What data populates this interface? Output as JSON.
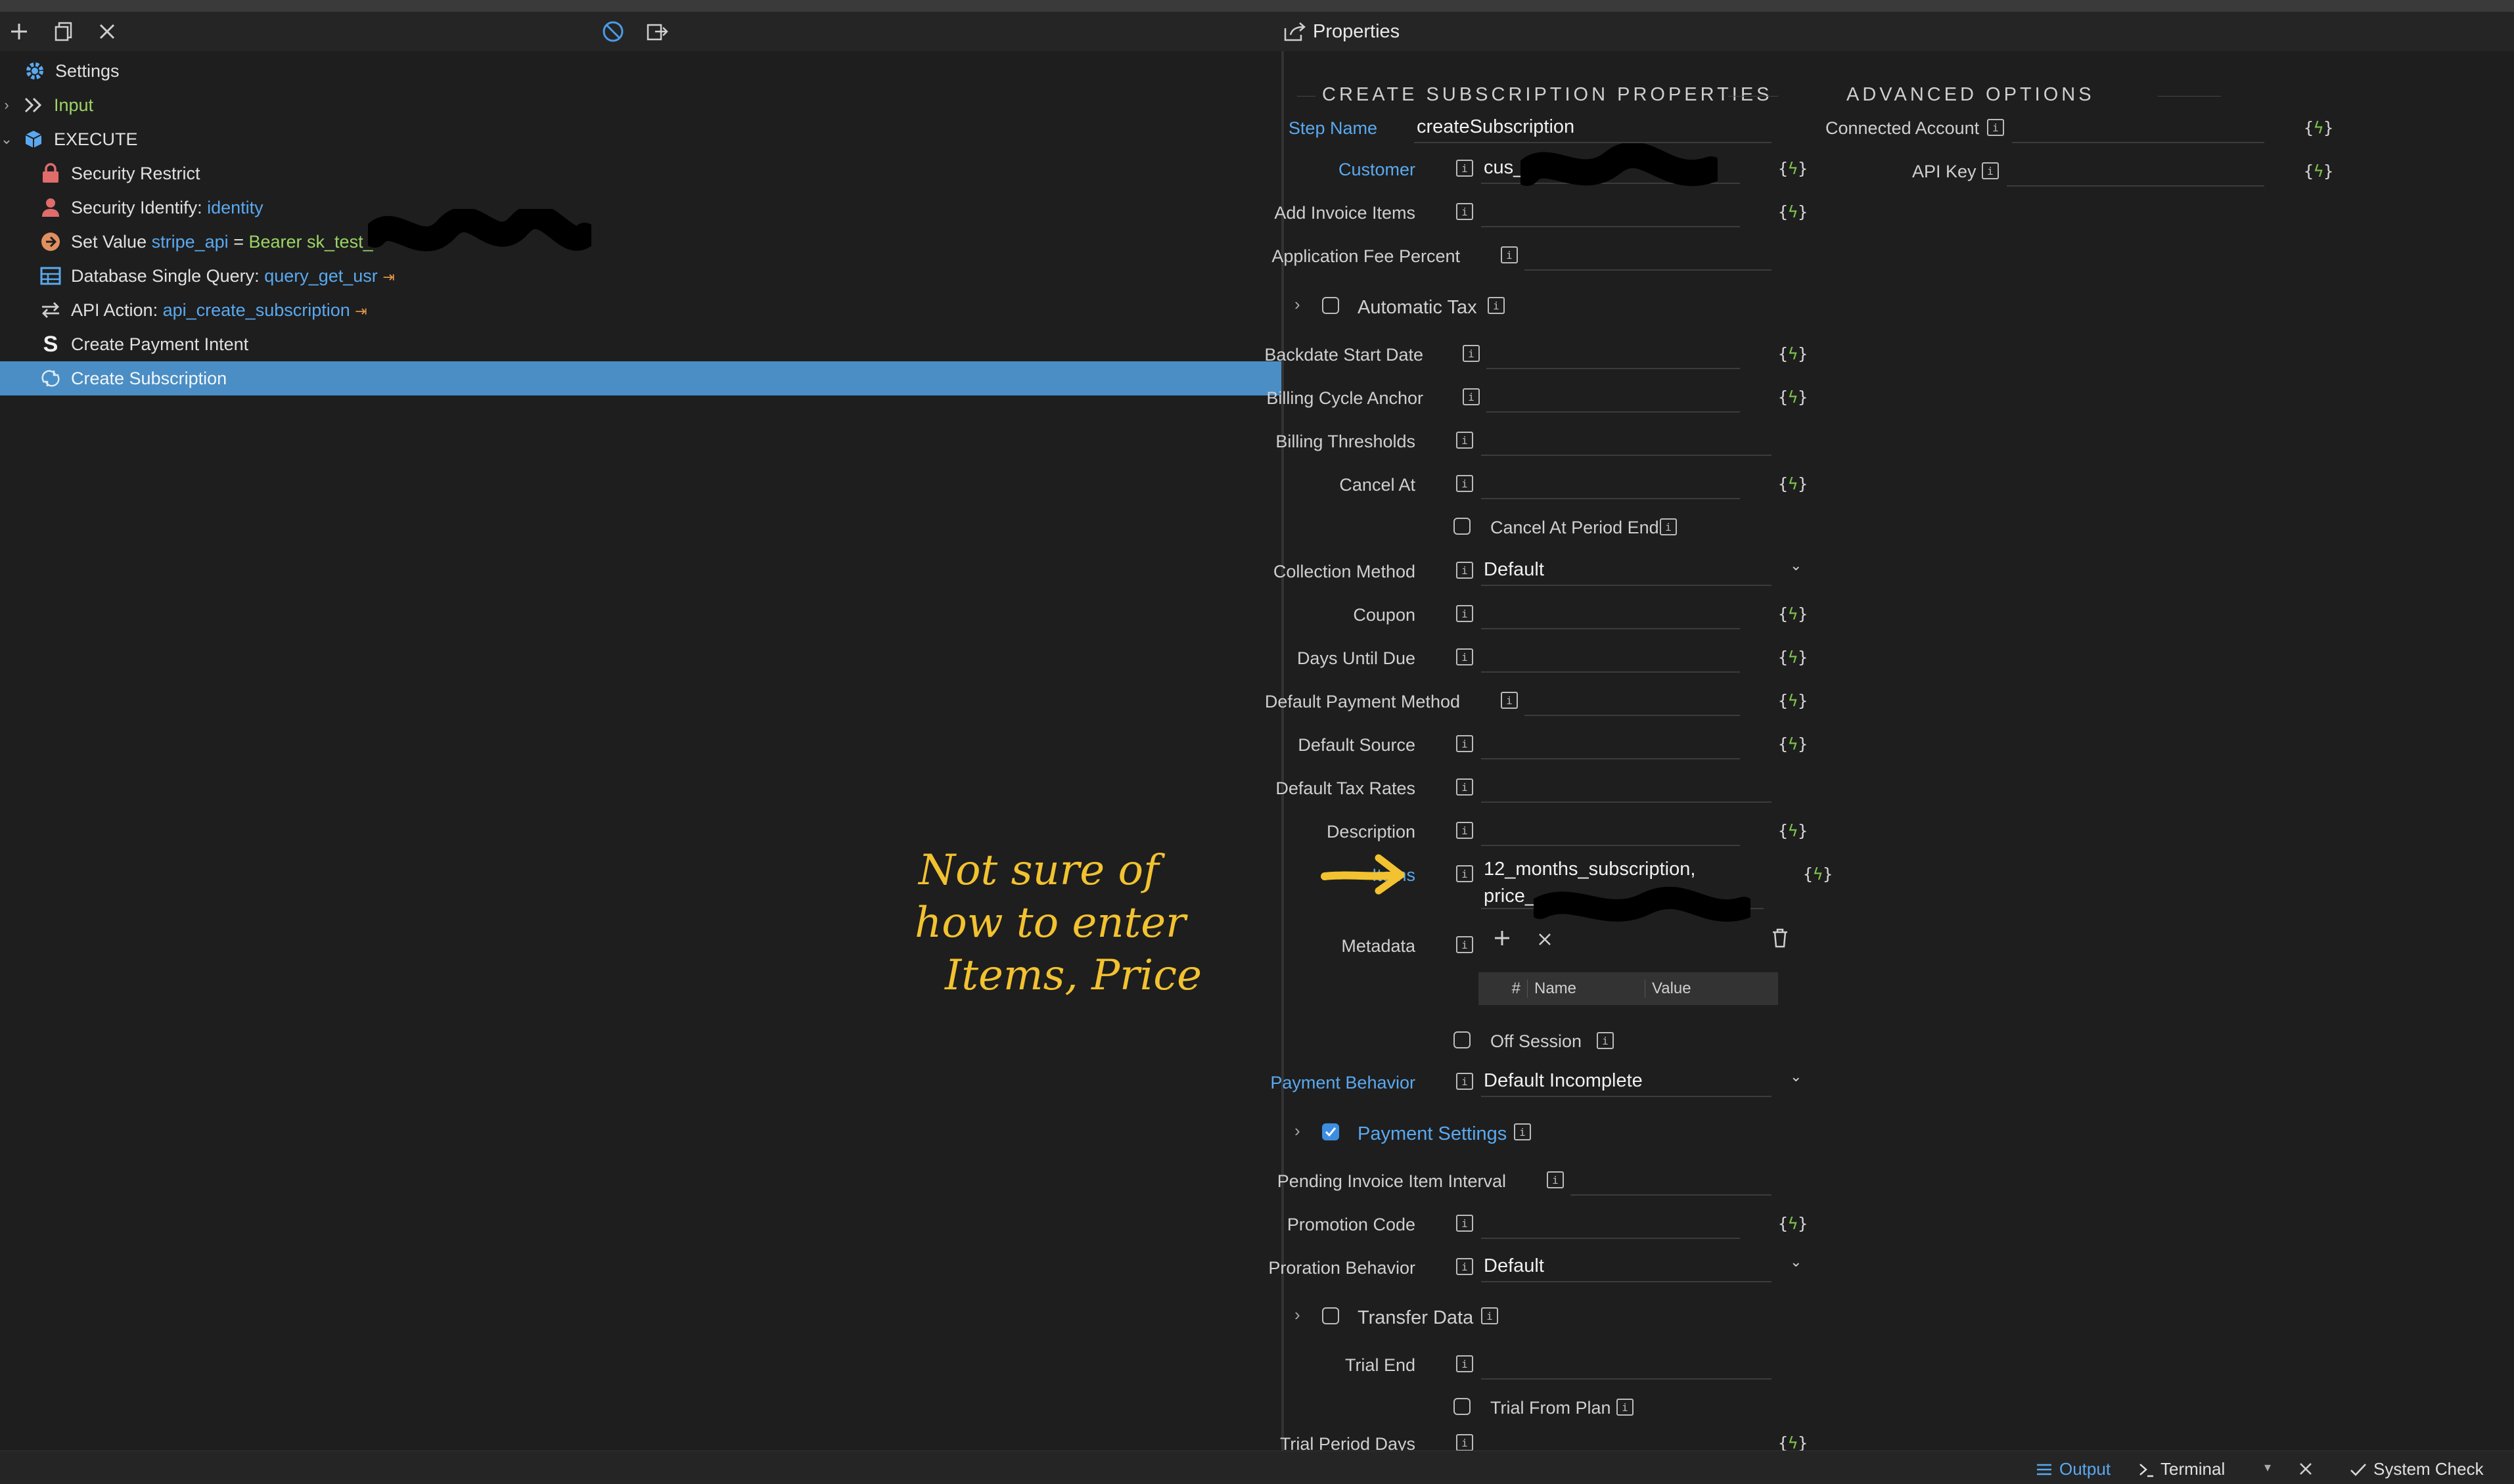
{
  "toolbar": {
    "icons": [
      "add-icon",
      "copy-icon",
      "close-icon",
      "disable-icon",
      "export-icon"
    ]
  },
  "properties_header": {
    "title": "Properties"
  },
  "tree": {
    "items": [
      {
        "label": "Settings"
      },
      {
        "label": "Input"
      },
      {
        "label": "EXECUTE"
      },
      {
        "label": "Security Restrict"
      },
      {
        "label": "Security Identify:",
        "value": "identity"
      },
      {
        "label": "Set Value",
        "value": "stripe_api",
        "op": "=",
        "expr": "Bearer sk_test_"
      },
      {
        "label": "Database Single Query:",
        "value": "query_get_usr"
      },
      {
        "label": "API Action:",
        "value": "api_create_subscription"
      },
      {
        "label": "Create Payment Intent"
      },
      {
        "label": "Create Subscription"
      }
    ]
  },
  "annotation": {
    "lines": [
      "Not sure of",
      "how to enter",
      "Items, Price"
    ]
  },
  "properties": {
    "section_title": "CREATE SUBSCRIPTION PROPERTIES",
    "advanced_title": "ADVANCED OPTIONS",
    "step_name": {
      "label": "Step Name",
      "value": "createSubscription"
    },
    "customer": {
      "label": "Customer",
      "value": "cus_L"
    },
    "add_invoice_items": {
      "label": "Add Invoice Items"
    },
    "application_fee_percent": {
      "label": "Application Fee Percent"
    },
    "automatic_tax": {
      "label": "Automatic Tax"
    },
    "backdate_start_date": {
      "label": "Backdate Start Date"
    },
    "billing_cycle_anchor": {
      "label": "Billing Cycle Anchor"
    },
    "billing_thresholds": {
      "label": "Billing Thresholds"
    },
    "cancel_at": {
      "label": "Cancel At"
    },
    "cancel_at_period_end": {
      "label": "Cancel At Period End"
    },
    "collection_method": {
      "label": "Collection Method",
      "value": "Default"
    },
    "coupon": {
      "label": "Coupon"
    },
    "days_until_due": {
      "label": "Days Until Due"
    },
    "default_payment_method": {
      "label": "Default Payment Method"
    },
    "default_source": {
      "label": "Default Source"
    },
    "default_tax_rates": {
      "label": "Default Tax Rates"
    },
    "description": {
      "label": "Description"
    },
    "items": {
      "label": "Items",
      "line1": "12_months_subscription,",
      "line2": "price_"
    },
    "metadata": {
      "label": "Metadata",
      "col_index": "#",
      "col_name": "Name",
      "col_value": "Value"
    },
    "off_session": {
      "label": "Off Session"
    },
    "payment_behavior": {
      "label": "Payment Behavior",
      "value": "Default Incomplete"
    },
    "payment_settings": {
      "label": "Payment Settings"
    },
    "pending_invoice_item_interval": {
      "label": "Pending Invoice Item Interval"
    },
    "promotion_code": {
      "label": "Promotion Code"
    },
    "proration_behavior": {
      "label": "Proration Behavior",
      "value": "Default"
    },
    "transfer_data": {
      "label": "Transfer Data"
    },
    "trial_end": {
      "label": "Trial End"
    },
    "trial_from_plan": {
      "label": "Trial From Plan"
    },
    "trial_period_days": {
      "label": "Trial Period Days"
    },
    "connected_account": {
      "label": "Connected Account"
    },
    "api_key": {
      "label": "API Key"
    }
  },
  "dynamic_symbol": {
    "open": "{",
    "glyph": "ϟ",
    "close": "}"
  },
  "info_glyph": "i",
  "status": {
    "output": "Output",
    "terminal": "Terminal",
    "system_check": "System Check"
  },
  "colors": {
    "accent": "#4a8ec5",
    "dynamic": "#7ec64a",
    "annotation": "#f2c230"
  }
}
